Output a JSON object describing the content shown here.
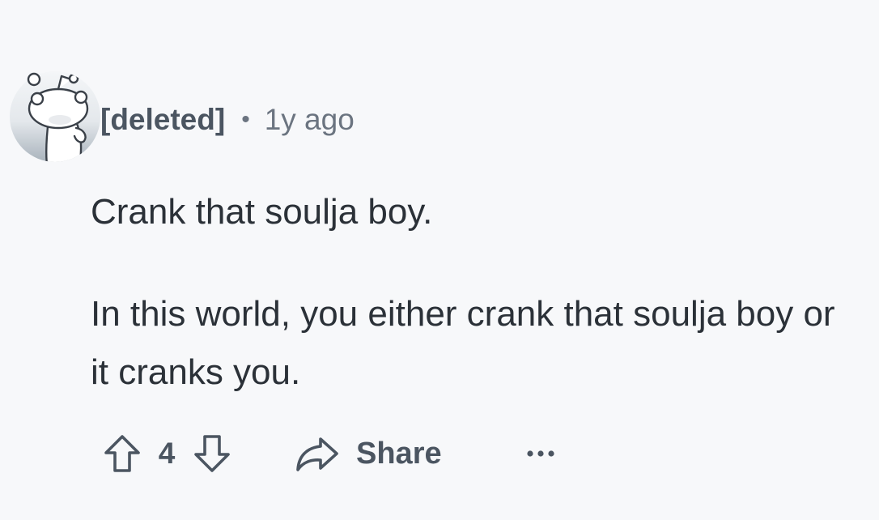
{
  "comment": {
    "author": "[deleted]",
    "separator": "•",
    "timestamp": "1y ago",
    "paragraphs": [
      "Crank that soulja boy.",
      "In this world, you either crank that soulja boy or it cranks you."
    ]
  },
  "actions": {
    "score": "4",
    "share_label": "Share"
  },
  "icons": {
    "avatar": "snoo-avatar-icon",
    "upvote": "upvote-arrow-icon",
    "downvote": "downvote-arrow-icon",
    "share": "share-arrow-icon",
    "more": "ellipsis-icon"
  },
  "colors": {
    "background": "#f7f8fa",
    "text": "#2b3138",
    "muted": "#4b5561"
  }
}
